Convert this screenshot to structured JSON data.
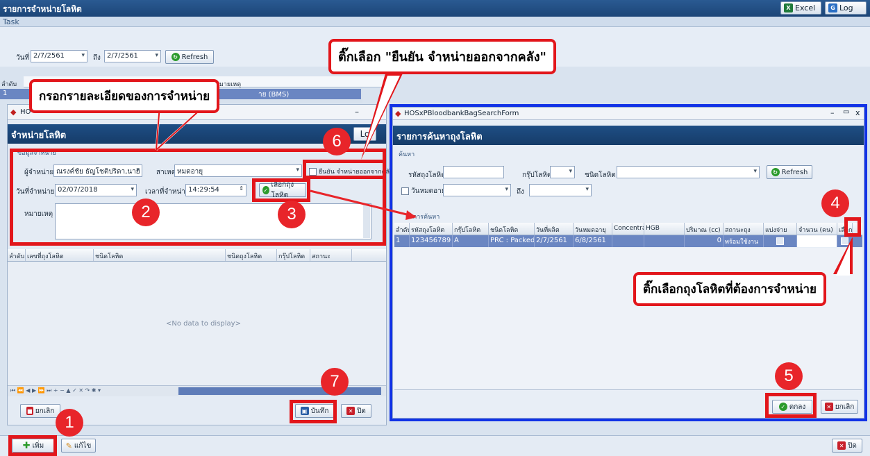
{
  "app": {
    "title": "รายการจำหน่ายโลหิต",
    "excel_label": "Excel",
    "log_label": "Log",
    "task_label": "Task",
    "date_label": "วันที่",
    "date_from": "2/7/2561",
    "to_label": "ถึง",
    "date_to": "2/7/2561",
    "refresh_label": "Refresh",
    "grid_order_header": "ลำดับ",
    "grid_note_header": "หมายเหตุ",
    "grid_row_index": "1",
    "grid_row_partial": "าย (BMS)",
    "add_label": "เพิ่ม",
    "edit_label": "แก้ไข",
    "close_label": "ปิด"
  },
  "dispense": {
    "window_title": "HO",
    "header": "จำหน่ายโลหิต",
    "header_btn_partial": "Lo",
    "group_label": "ข้อมูลจำหน่าย",
    "dispenser_label": "ผู้จำหน่าย",
    "dispenser_value": "ณรงค์ชัย ธัญโชติปริดา,นาย (I",
    "reason_label": "สาเหตุ",
    "reason_value": "หมดอายุ",
    "confirm_label": "ยืนยัน จำหน่ายออกจากคลัง",
    "date_label": "วันที่จำหน่าย",
    "date_value": "02/07/2018",
    "time_label": "เวลาที่จำหน่าย",
    "time_value": "14:29:54",
    "select_bag_label": "เลือกถุงโลหิต",
    "note_label": "หมายเหตุ",
    "columns": [
      "ลำดับ",
      "เลขที่ถุงโลหิต",
      "ชนิดโลหิต",
      "ชนิดถุงโลหิต",
      "กรุ๊ปโลหิต",
      "สถานะ"
    ],
    "empty_text": "<No data to display>",
    "nav_text": "⏮ ⏪ ◀ ▶ ⏩ ⏭ + − ▲ ✓ ✕ ↷ ✱ ▾",
    "cancel_label": "ยกเลิก",
    "save_label": "บันทึก",
    "close_label": "ปิด"
  },
  "search": {
    "window_title": "HOSxPBloodbankBagSearchForm",
    "header": "รายการค้นหาถุงโลหิต",
    "group_label": "ค้นหา",
    "bag_id_label": "รหัสถุงโลหิต",
    "group_field_label": "กรุ๊ปโลหิต",
    "type_label": "ชนิดโลหิต",
    "refresh_label": "Refresh",
    "expire_label": "วันหมดอายุ",
    "to_label": "ถึง",
    "result_label": "ผลการค้นหา",
    "columns": [
      "ลำดับ",
      "รหัสถุงโลหิต",
      "กรุ๊ปโลหิต",
      "ชนิดโลหิต",
      "วันที่ผลิต",
      "วันหมดอายุ",
      "Concentra",
      "HGB",
      "ปริมาณ (cc)",
      "สถานะถุง",
      "แบ่งจ่าย",
      "จำนวน (คน)",
      "เลือก"
    ],
    "row": [
      "1",
      "123456789",
      "A",
      "PRC : Packed",
      "2/7/2561",
      "6/8/2561",
      "",
      "",
      "0",
      "พร้อมใช้งาน",
      "",
      "",
      ""
    ],
    "ok_label": "ตกลง",
    "cancel_label": "ยกเลิก"
  },
  "annotations": {
    "callout_fill": "กรอกรายละเอียดของการจำหน่าย",
    "callout_confirm": "ติ๊กเลือก \"ยืนยัน จำหน่ายออกจากคลัง\"",
    "callout_select": "ติ๊กเลือกถุงโลหิตที่ต้องการจำหน่าย",
    "steps": [
      "1",
      "2",
      "3",
      "4",
      "5",
      "6",
      "7"
    ],
    "red": "#e2161b",
    "blue": "#1132e6"
  }
}
